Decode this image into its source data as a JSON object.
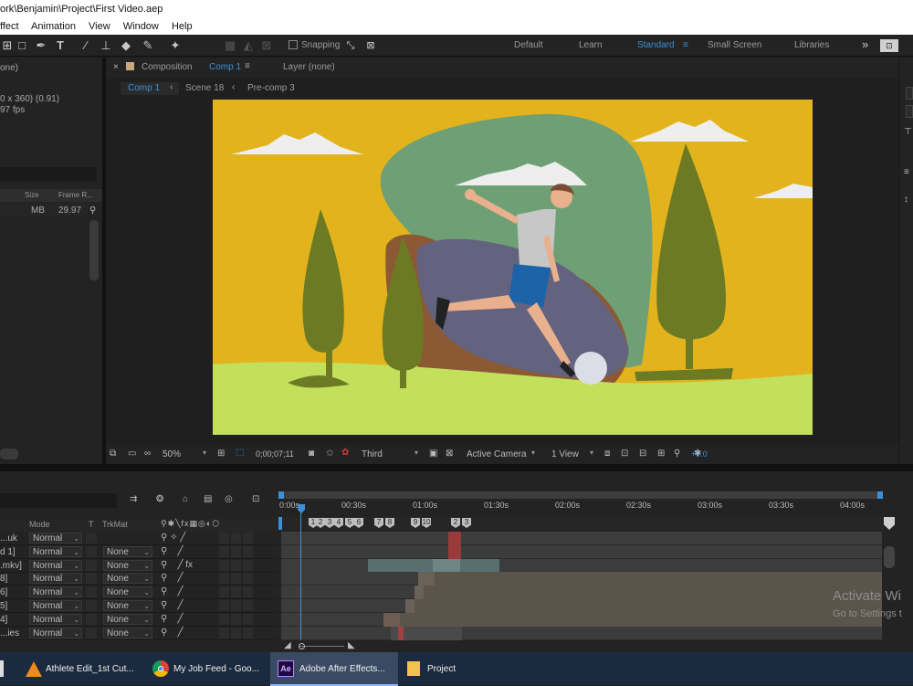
{
  "window": {
    "title": "ork\\Benjamin\\Project\\First Video.aep"
  },
  "menu": [
    "ffect",
    "Animation",
    "View",
    "Window",
    "Help"
  ],
  "toolbar": {
    "snapping_label": "Snapping",
    "workspaces": [
      "Default",
      "Learn",
      "Standard",
      "Small Screen",
      "Libraries"
    ],
    "active_workspace": "Standard",
    "more_glyph": "»"
  },
  "project_panel": {
    "none_label": "one)",
    "dims": "0 x 360) (0.91)",
    "fps": "97 fps",
    "col_size": "Size",
    "col_frame_rate": "Frame R...",
    "item_size": "MB",
    "item_fps": "29.97"
  },
  "comp_panel": {
    "tab_prefix": "Composition",
    "tab_comp": "Comp 1",
    "layer_tab": "Layer  (none)",
    "breadcrumbs": [
      "Comp 1",
      "Scene 18",
      "Pre-comp 3"
    ],
    "zoom": "50%",
    "timecode": "0;00;07;11",
    "resolution": "Third",
    "camera": "Active Camera",
    "views": "1 View",
    "exposure": "+0.0"
  },
  "timeline": {
    "col_mode": "Mode",
    "col_t": "T",
    "col_trkmat": "TrkMat",
    "ruler": [
      "0:00s",
      "00:30s",
      "01:00s",
      "01:30s",
      "02:00s",
      "02:30s",
      "03:00s",
      "03:30s",
      "04:00s"
    ],
    "markers": [
      "1",
      "2",
      "3",
      "4",
      "5",
      "6",
      "7",
      "8",
      "9",
      "10",
      "2",
      "3"
    ],
    "layers": [
      {
        "name": "...uk",
        "mode": "Normal",
        "trkmat": ""
      },
      {
        "name": "d 1]",
        "mode": "Normal",
        "trkmat": "None"
      },
      {
        "name": ".mkv]",
        "mode": "Normal",
        "trkmat": "None"
      },
      {
        "name": "8]",
        "mode": "Normal",
        "trkmat": "None"
      },
      {
        "name": "6]",
        "mode": "Normal",
        "trkmat": "None"
      },
      {
        "name": "5]",
        "mode": "Normal",
        "trkmat": "None"
      },
      {
        "name": "4]",
        "mode": "Normal",
        "trkmat": "None"
      },
      {
        "name": "...ies",
        "mode": "Normal",
        "trkmat": "None"
      }
    ],
    "fx_label": "fx"
  },
  "watermark": {
    "line1": "Activate Wi",
    "line2": "Go to Settings t"
  },
  "taskbar": {
    "items": [
      "Athlete Edit_1st Cut...",
      "My Job Feed - Goo...",
      "Adobe After Effects...",
      "Project"
    ],
    "ae_icon_text": "Ae"
  },
  "colors": {
    "accent": "#3d8fd8",
    "scene_bg": "#e2b31d",
    "grass": "#c3e05c",
    "tree": "#6c7a23",
    "blob_green": "#6e9f75",
    "rock": "#63627f",
    "shirt": "#c7c7c7",
    "shorts": "#1d63a7"
  }
}
